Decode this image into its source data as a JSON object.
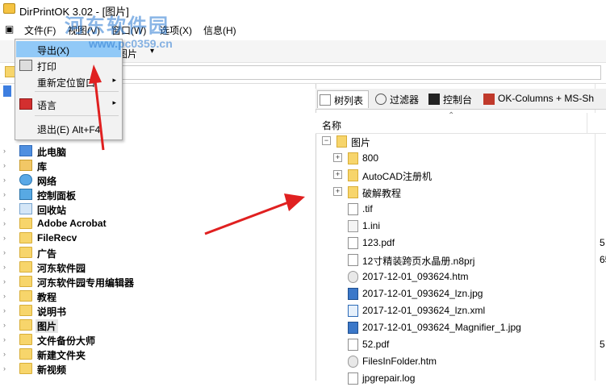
{
  "window": {
    "title": "DirPrintOK 3.02 - [图片]"
  },
  "menubar": [
    "文件(F)",
    "视图(V)",
    "窗口(W)",
    "选项(X)",
    "信息(H)"
  ],
  "toolbar": {
    "label": "图片",
    "arrow": "▾"
  },
  "file_menu": {
    "items": [
      {
        "label": "导出(X)"
      },
      {
        "label": "打印"
      },
      {
        "label": "重新定位窗口",
        "submenu": "▸"
      },
      {
        "label": "语言",
        "submenu": "▸"
      },
      {
        "label": "退出(E)  Alt+F4"
      }
    ]
  },
  "tree": {
    "items": [
      {
        "label": "此电脑",
        "icon": "pc-icon"
      },
      {
        "label": "库",
        "icon": "library-icon"
      },
      {
        "label": "网络",
        "icon": "network-icon"
      },
      {
        "label": "控制面板",
        "icon": "control-panel-icon"
      },
      {
        "label": "回收站",
        "icon": "recycle-bin-icon"
      },
      {
        "label": "Adobe Acrobat",
        "icon": "folder-icon"
      },
      {
        "label": "FileRecv",
        "icon": "folder-icon"
      },
      {
        "label": "广告",
        "icon": "folder-icon"
      },
      {
        "label": "河东软件园",
        "icon": "folder-icon"
      },
      {
        "label": "河东软件园专用编辑器",
        "icon": "folder-icon"
      },
      {
        "label": "教程",
        "icon": "folder-icon"
      },
      {
        "label": "说明书",
        "icon": "folder-icon"
      },
      {
        "label": "图片",
        "icon": "folder-icon",
        "selected": true
      },
      {
        "label": "文件备份大师",
        "icon": "folder-icon"
      },
      {
        "label": "新建文件夹",
        "icon": "folder-icon"
      },
      {
        "label": "新视频",
        "icon": "folder-icon"
      }
    ]
  },
  "tabs": [
    "树列表",
    "过滤器",
    "控制台",
    "OK-Columns + MS-Sh"
  ],
  "columns": {
    "name": "名称"
  },
  "files": [
    {
      "name": "图片",
      "icon": "folder-icon",
      "level": 0,
      "expander": "−"
    },
    {
      "name": "800",
      "icon": "folder-icon",
      "level": 1,
      "expander": "+"
    },
    {
      "name": "AutoCAD注册机",
      "icon": "folder-icon",
      "level": 1,
      "expander": "+"
    },
    {
      "name": "破解教程",
      "icon": "folder-icon",
      "level": 1,
      "expander": "+"
    },
    {
      "name": ".tif",
      "icon": "file-icon",
      "level": 1
    },
    {
      "name": "1.ini",
      "icon": "ini-file-icon",
      "level": 1
    },
    {
      "name": "123.pdf",
      "icon": "pdf-icon",
      "level": 1,
      "size": "5"
    },
    {
      "name": "12寸精装跨页水晶册.n8prj",
      "icon": "file-icon",
      "level": 1,
      "size": "65"
    },
    {
      "name": "2017-12-01_093624.htm",
      "icon": "chrome-icon",
      "level": 1
    },
    {
      "name": "2017-12-01_093624_lzn.jpg",
      "icon": "image-icon",
      "level": 1
    },
    {
      "name": "2017-12-01_093624_lzn.xml",
      "icon": "ie-icon",
      "level": 1
    },
    {
      "name": "2017-12-01_093624_Magnifier_1.jpg",
      "icon": "image-icon",
      "level": 1
    },
    {
      "name": "52.pdf",
      "icon": "pdf-icon",
      "level": 1,
      "size": "5"
    },
    {
      "name": "FilesInFolder.htm",
      "icon": "chrome-icon",
      "level": 1
    },
    {
      "name": "jpgrepair.log",
      "icon": "log-icon",
      "level": 1
    }
  ],
  "watermark": {
    "text": "河东软件园",
    "url": "www.pc0359.cn"
  }
}
